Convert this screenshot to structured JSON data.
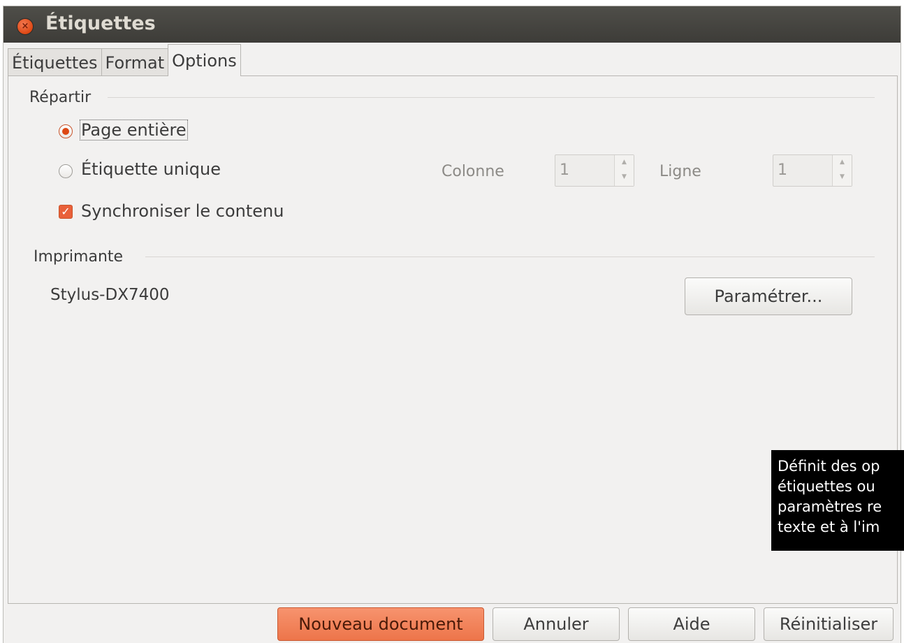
{
  "window": {
    "title": "Étiquettes",
    "close_icon": "close-icon"
  },
  "tabs": [
    {
      "label": "Étiquettes",
      "active": false
    },
    {
      "label": "Format",
      "active": false
    },
    {
      "label": "Options",
      "active": true
    }
  ],
  "distribute": {
    "group_label": "Répartir",
    "page_entire": {
      "label": "Page entière",
      "selected": true
    },
    "single_label": {
      "label": "Étiquette unique",
      "selected": false
    },
    "column_label": "Colonne",
    "column_value": "1",
    "row_label": "Ligne",
    "row_value": "1",
    "sync": {
      "label": "Synchroniser le contenu",
      "checked": true
    }
  },
  "printer": {
    "group_label": "Imprimante",
    "name": "Stylus-DX7400",
    "setup_button": "Paramétrer..."
  },
  "buttons": {
    "new_document": "Nouveau document",
    "cancel": "Annuler",
    "help": "Aide",
    "reset": "Réinitialiser"
  },
  "tooltip": {
    "lines": [
      "Définit des op",
      "étiquettes ou",
      "paramètres re",
      "texte et à l'im"
    ]
  },
  "colors": {
    "accent": "#dd4814",
    "titlebar": "#3d3c38",
    "background": "#f2f1f0"
  }
}
